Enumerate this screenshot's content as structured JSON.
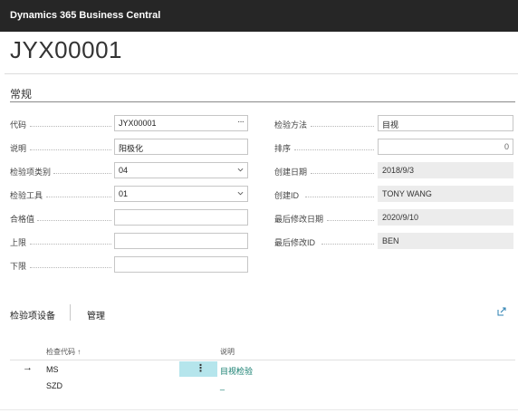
{
  "app": {
    "title": "Dynamics 365 Business Central"
  },
  "page": {
    "title": "JYX00001",
    "section": "常规"
  },
  "left_fields": [
    {
      "label": "代码",
      "value": "JYX00001",
      "type": "lookup"
    },
    {
      "label": "说明",
      "value": "阳极化",
      "type": "text"
    },
    {
      "label": "检验项类别",
      "value": "04",
      "type": "dropdown"
    },
    {
      "label": "检验工具",
      "value": "01",
      "type": "dropdown"
    },
    {
      "label": "合格值",
      "value": "",
      "type": "text"
    },
    {
      "label": "上限",
      "value": "",
      "type": "text"
    },
    {
      "label": "下限",
      "value": "",
      "type": "text"
    }
  ],
  "right_fields": [
    {
      "label": "检验方法",
      "value": "目视",
      "type": "text"
    },
    {
      "label": "排序",
      "value": "0",
      "type": "number"
    },
    {
      "label": "创建日期",
      "value": "2018/9/3",
      "type": "readonly"
    },
    {
      "label": "创建ID",
      "value": "TONY WANG",
      "type": "readonly"
    },
    {
      "label": "最后修改日期",
      "value": "2020/9/10",
      "type": "readonly"
    },
    {
      "label": "最后修改ID",
      "value": "BEN",
      "type": "readonly"
    }
  ],
  "subpage": {
    "tabs": [
      "检验项设备",
      "管理"
    ],
    "columns": [
      "检查代码 ↑",
      "说明"
    ],
    "rows": [
      {
        "code": "MS",
        "description": "目视检验",
        "selected": true
      },
      {
        "code": "SZD",
        "description": "_"
      }
    ]
  },
  "icons": {
    "expand": "expand-icon",
    "row_menu": "more-vertical-icon",
    "lookup": "ellipsis-icon",
    "dropdown": "chevron-down-icon"
  },
  "colors": {
    "header": "#262626",
    "link": "#0e7a6b",
    "selection": "#b5e5ec"
  }
}
